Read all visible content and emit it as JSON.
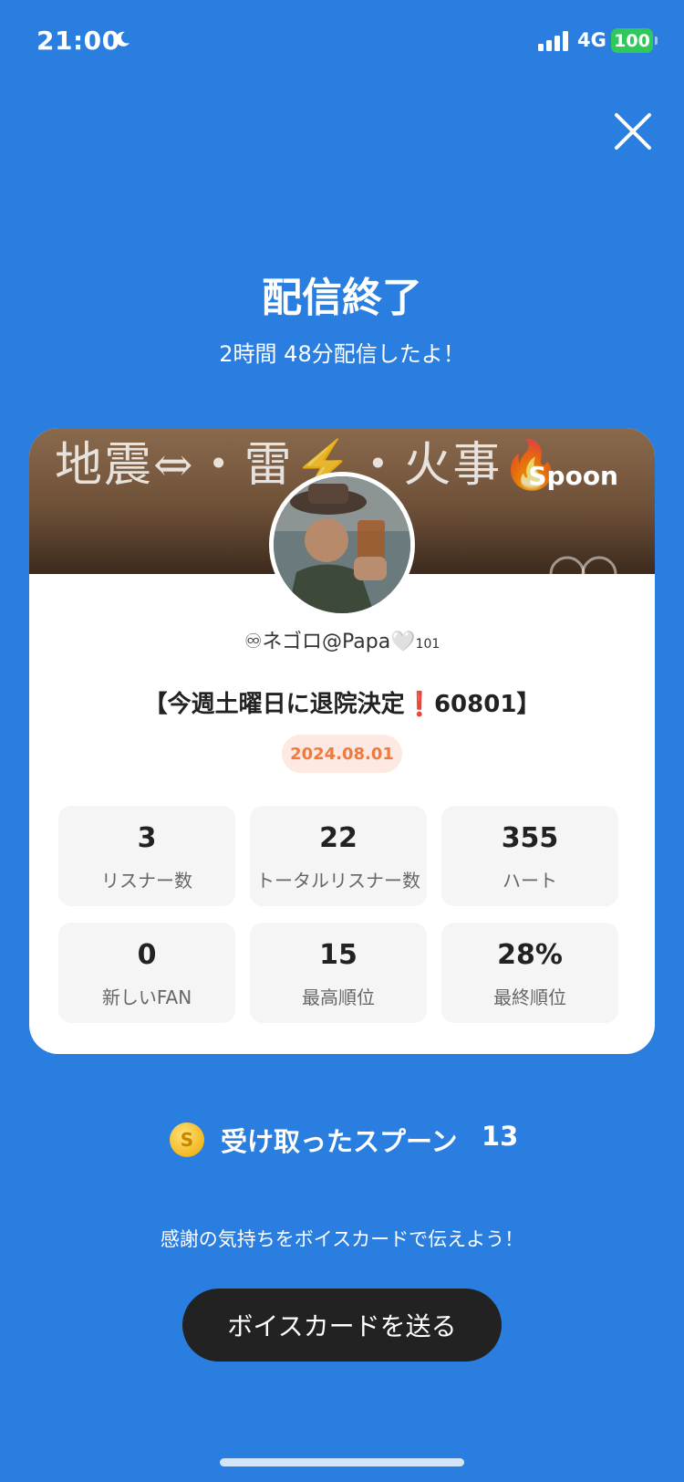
{
  "status_bar": {
    "time": "21:00",
    "moon_icon": "moon-icon",
    "signal_icon": "signal-icon",
    "network": "4G",
    "battery": "100"
  },
  "header": {
    "close_icon": "close-icon",
    "title": "配信終了",
    "subtitle": "2時間 48分配信したよ！"
  },
  "card": {
    "banner_text": "地震⇔・雷⚡・火事🔥",
    "banner_logo": "Spoon",
    "username": "♾ネゴロ@Papa🤍",
    "username_count": "101",
    "stream_title": "【今週土曜日に退院決定❗️60801】",
    "date": "2024.08.01",
    "stats": [
      {
        "value": "3",
        "label": "リスナー数"
      },
      {
        "value": "22",
        "label": "トータルリスナー数"
      },
      {
        "value": "355",
        "label": "ハート"
      },
      {
        "value": "0",
        "label": "新しいFAN"
      },
      {
        "value": "15",
        "label": "最高順位"
      },
      {
        "value": "28%",
        "label": "最終順位"
      }
    ]
  },
  "spoons": {
    "coin_icon": "spoon-coin-icon",
    "coin_symbol": "S",
    "label": "受け取ったスプーン",
    "count": "13"
  },
  "footer": {
    "thanks_text": "感謝の気持ちをボイスカードで伝えよう！",
    "voice_button_label": "ボイスカードを送る"
  },
  "colors": {
    "background": "#2a7ee0",
    "card": "#ffffff",
    "date_badge_bg": "#fde8e2",
    "date_badge_text": "#f07a3e",
    "button_bg": "#222222",
    "battery": "#30c85a"
  }
}
